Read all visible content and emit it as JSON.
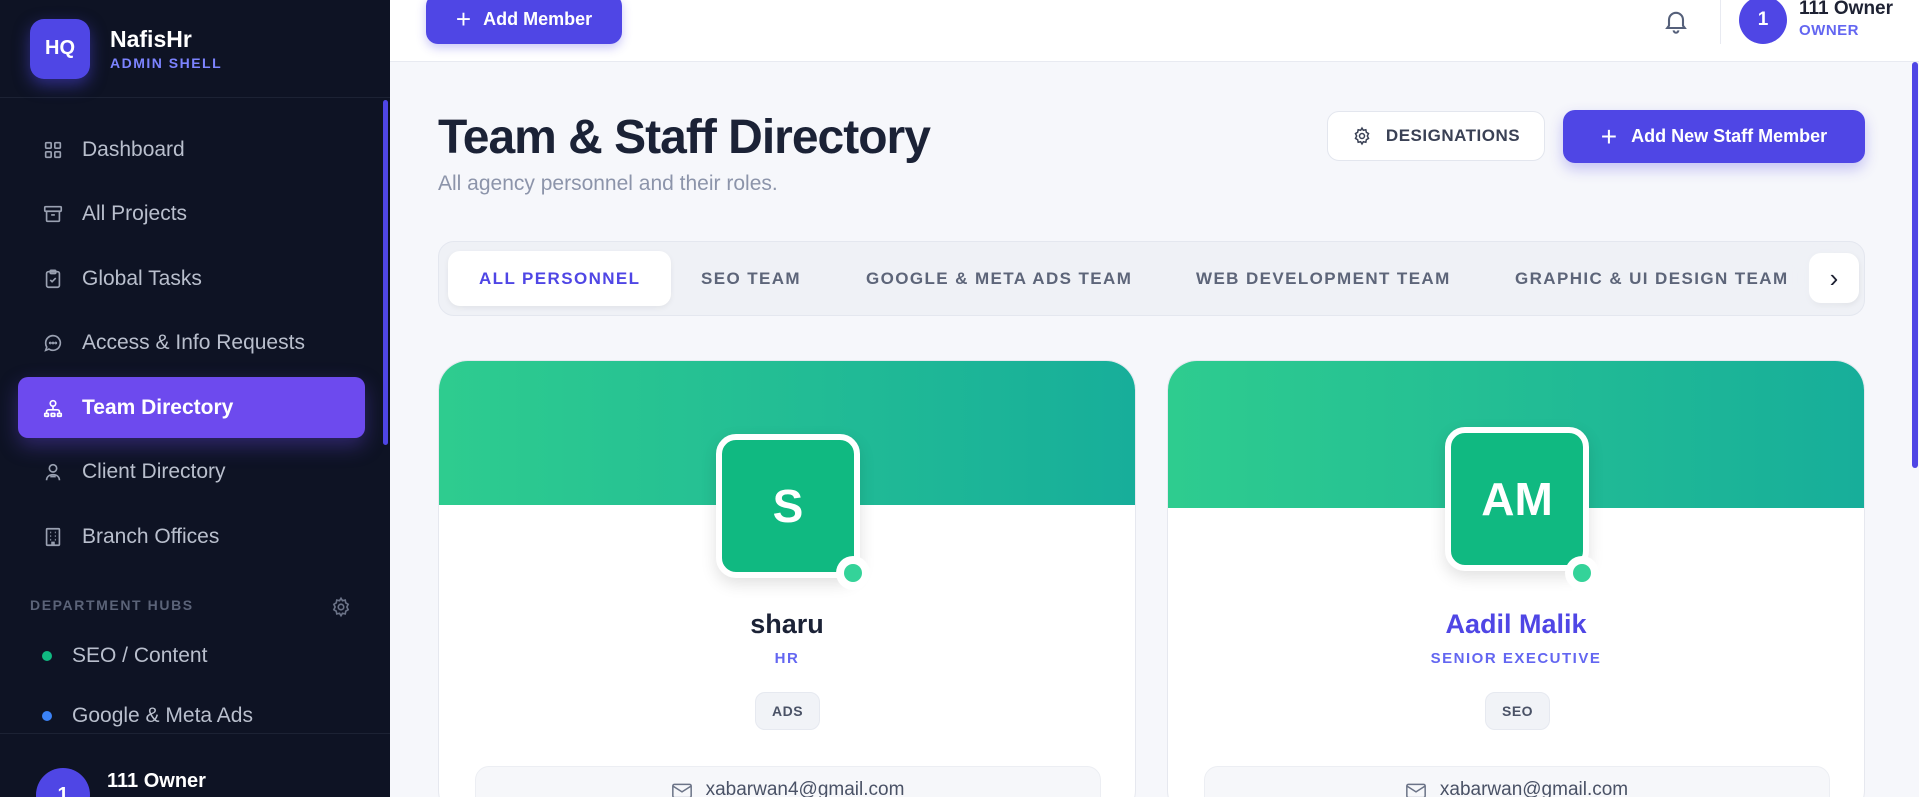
{
  "brand": {
    "logo": "HQ",
    "name": "NafisHr",
    "subtitle": "ADMIN SHELL"
  },
  "sidebar": {
    "items": [
      {
        "label": "Dashboard",
        "icon": "grid-icon"
      },
      {
        "label": "All Projects",
        "icon": "archive-icon"
      },
      {
        "label": "Global Tasks",
        "icon": "clipboard-icon"
      },
      {
        "label": "Access & Info Requests",
        "icon": "chat-icon"
      },
      {
        "label": "Team Directory",
        "icon": "team-icon",
        "active": true
      },
      {
        "label": "Client Directory",
        "icon": "users-icon"
      },
      {
        "label": "Branch Offices",
        "icon": "building-icon"
      }
    ],
    "hubs_title": "DEPARTMENT HUBS",
    "hubs": [
      {
        "label": "SEO / Content",
        "color": "#10b981"
      },
      {
        "label": "Google & Meta Ads",
        "color": "#3b82f6"
      }
    ],
    "footer_user": {
      "avatar": "1",
      "name": "111 Owner"
    }
  },
  "topbar": {
    "add_member_label": "Add Member",
    "user": {
      "avatar": "1",
      "name": "111 Owner",
      "role": "OWNER"
    }
  },
  "page": {
    "title": "Team & Staff Directory",
    "subtitle": "All agency personnel and their roles.",
    "designations_label": "DESIGNATIONS",
    "add_staff_label": "Add New Staff Member"
  },
  "tabs": [
    {
      "label": "ALL PERSONNEL",
      "active": true
    },
    {
      "label": "SEO TEAM"
    },
    {
      "label": "GOOGLE & META ADS TEAM"
    },
    {
      "label": "WEB DEVELOPMENT TEAM"
    },
    {
      "label": "GRAPHIC & UI DESIGN TEAM"
    }
  ],
  "cards": [
    {
      "initials": "S",
      "name": "sharu",
      "role": "HR",
      "department": "ADS",
      "email": "xabarwan4@gmail.com",
      "name_color": "#1b2236"
    },
    {
      "initials": "AM",
      "name": "Aadil Malik",
      "role": "SENIOR EXECUTIVE",
      "department": "SEO",
      "email": "xabarwan@gmail.com",
      "name_color": "#4f46e5"
    }
  ],
  "colors": {
    "accent": "#4f46e5",
    "sidebar_bg": "#0e1324",
    "active_nav": "#6d4aee",
    "banner": "#2ecc8f",
    "avatar_bg": "#10b981"
  }
}
